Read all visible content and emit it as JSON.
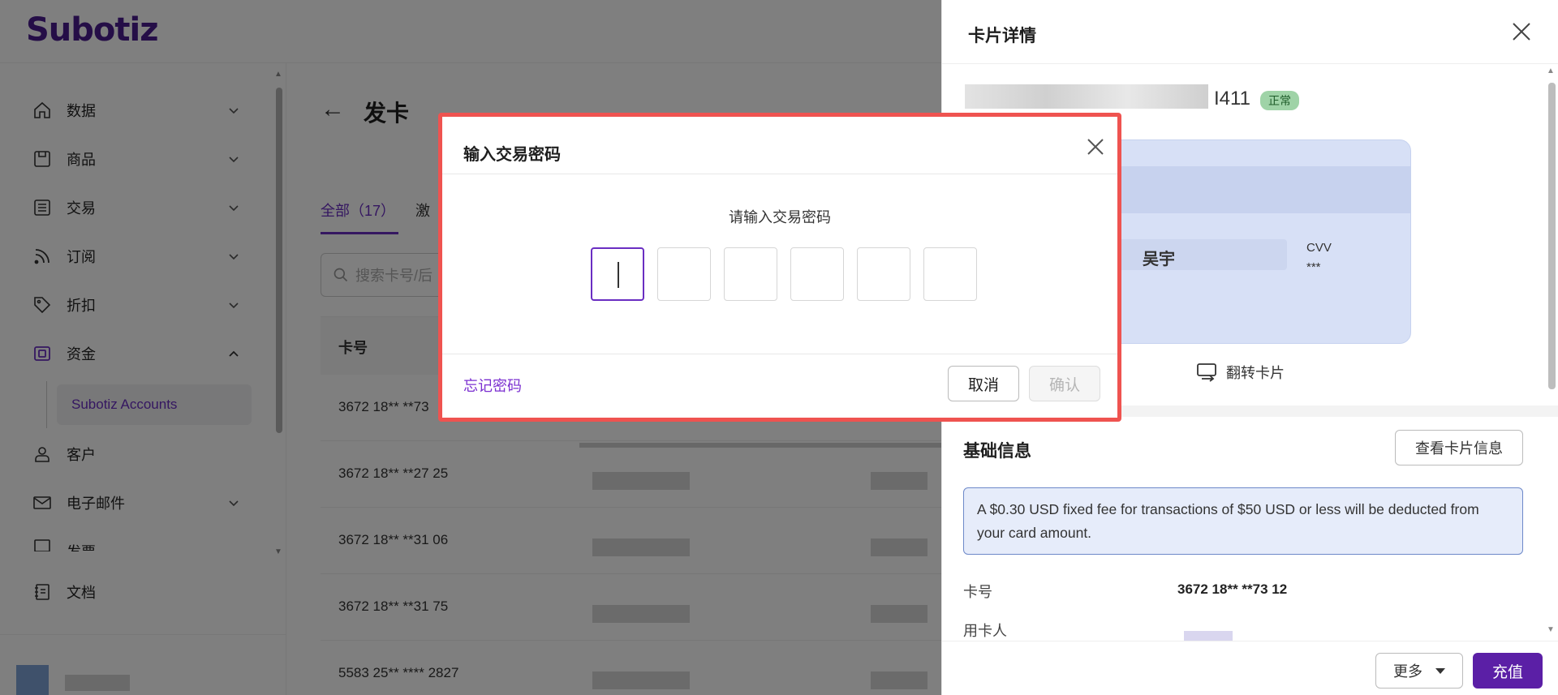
{
  "app": {
    "logo": "Subotiz"
  },
  "sidebar": {
    "items": [
      {
        "label": "数据",
        "icon": "home-icon"
      },
      {
        "label": "商品",
        "icon": "product-icon"
      },
      {
        "label": "交易",
        "icon": "list-icon"
      },
      {
        "label": "订阅",
        "icon": "rss-icon"
      },
      {
        "label": "折扣",
        "icon": "tag-icon"
      },
      {
        "label": "资金",
        "icon": "wallet-icon"
      },
      {
        "label": "客户",
        "icon": "user-icon"
      },
      {
        "label": "电子邮件",
        "icon": "mail-icon"
      },
      {
        "label": "发票",
        "icon": "invoice-icon"
      },
      {
        "label": "文档",
        "icon": "doc-icon"
      }
    ],
    "sub_item": "Subotiz Accounts"
  },
  "main": {
    "title": "发卡",
    "tabs": [
      {
        "label": "全部（17）"
      },
      {
        "label": "激"
      }
    ],
    "search_placeholder": "搜索卡号/后",
    "table_header": "卡号",
    "rows": [
      "3672 18** **73",
      "3672 18** **27 25",
      "3672 18** **31 06",
      "3672 18** **31 75",
      "5583 25** **** 2827"
    ]
  },
  "panel": {
    "title": "卡片详情",
    "card_tail": "I411",
    "status": "正常",
    "card_name": "吴宇",
    "cvv_label": "CVV",
    "cvv_value": "***",
    "flip_label": "翻转卡片",
    "section_title": "基础信息",
    "view_card_label": "查看卡片信息",
    "notice": "A $0.30 USD fixed fee for transactions of $50 USD or less will be deducted from your card amount.",
    "card_no_label": "卡号",
    "card_no_value": "3672 18** **73 12",
    "holder_label": "用卡人",
    "more_label": "更多",
    "recharge_label": "充值"
  },
  "modal": {
    "title": "输入交易密码",
    "prompt": "请输入交易密码",
    "pin_count": 6,
    "forgot_label": "忘记密码",
    "cancel_label": "取消",
    "confirm_label": "确认"
  },
  "colors": {
    "brand": "#4b1c8f",
    "accent": "#6a2ec2",
    "highlight_border": "#ef5350",
    "status_bg": "#9fd3a7"
  }
}
